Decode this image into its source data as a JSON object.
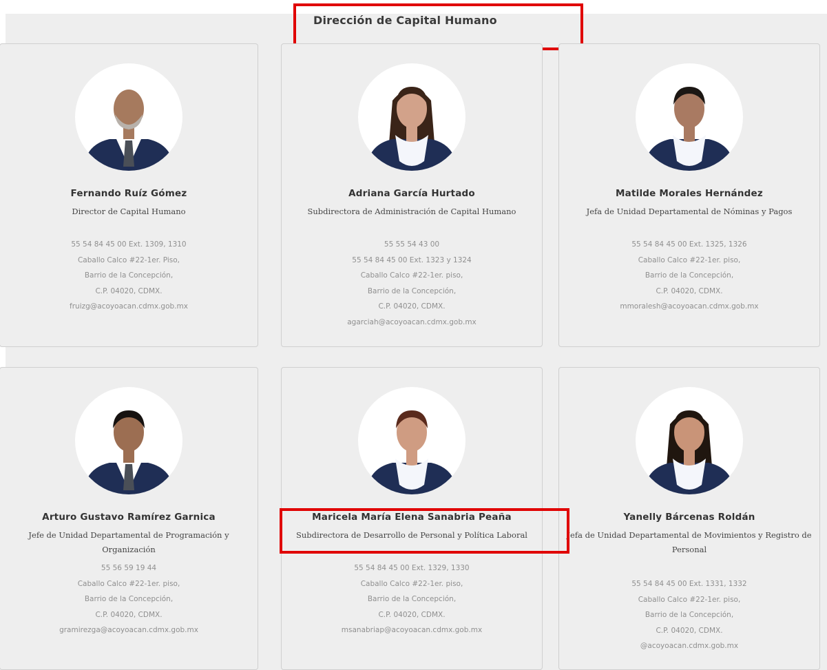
{
  "section": {
    "title": "Dirección de Capital Humano"
  },
  "colors": {
    "highlight": "#e00000",
    "card_bg": "#eeeeee",
    "suit": "#1f2e55",
    "scarf": "#f4f6fb"
  },
  "people": [
    {
      "name": "Fernando Ruíz Gómez",
      "role": "Director de Capital Humano",
      "details": [
        "55 54 84 45 00 Ext. 1309, 1310",
        "Caballo Calco #22-1er. Piso,",
        "Barrio de la Concepción,",
        "C.P. 04020, CDMX.",
        "fruizg@acoyoacan.cdmx.gob.mx"
      ],
      "photo": {
        "hair": "#2e2620",
        "skin": "#a67a5e",
        "outfit": "tie",
        "bald": true,
        "beard": true
      }
    },
    {
      "name": "Adriana García Hurtado",
      "role": "Subdirectora de Administración de Capital Humano",
      "details": [
        "55 55 54 43 00",
        "55 54 84 45 00 Ext. 1323 y 1324",
        "Caballo Calco #22-1er. piso,",
        "Barrio de la Concepción,",
        "C.P. 04020, CDMX.",
        "agarciah@acoyoacan.cdmx.gob.mx"
      ],
      "photo": {
        "hair": "#3a2418",
        "skin": "#d2a28a",
        "outfit": "scarf",
        "long_hair": true
      }
    },
    {
      "name": "Matilde Morales Hernández",
      "role": "Jefa de Unidad Departamental de Nóminas y Pagos",
      "details": [
        "55 54 84 45 00 Ext. 1325, 1326",
        "Caballo Calco #22-1er. piso,",
        "Barrio de la Concepción,",
        "C.P. 04020, CDMX.",
        "mmoralesh@acoyoacan.cdmx.gob.mx"
      ],
      "photo": {
        "hair": "#1c1714",
        "skin": "#a97a62",
        "outfit": "scarf"
      }
    },
    {
      "name": "Arturo Gustavo Ramírez Garnica",
      "role": "Jefe de Unidad Departamental de Programación y Organización",
      "details": [
        "55 56 59 19 44",
        "Caballo Calco #22-1er. piso,",
        "Barrio de la Concepción,",
        "C.P. 04020, CDMX.",
        "gramirezga@acoyoacan.cdmx.gob.mx"
      ],
      "photo": {
        "hair": "#161210",
        "skin": "#9c6e52",
        "outfit": "tie"
      }
    },
    {
      "name": "Maricela María Elena Sanabria Peaña",
      "role": "Subdirectora de Desarrollo de Personal y Política Laboral",
      "details": [
        "55 54 84 45 00 Ext. 1329, 1330",
        "Caballo Calco #22-1er. piso,",
        "Barrio de la Concepción,",
        "C.P. 04020, CDMX.",
        "msanabriap@acoyoacan.cdmx.gob.mx"
      ],
      "photo": {
        "hair": "#5a2a1c",
        "skin": "#cf9c82",
        "outfit": "scarf"
      }
    },
    {
      "name": "Yanelly Bárcenas Roldán",
      "role": "Jefa de Unidad Departamental de Movimientos y Registro de Personal",
      "details": [
        "55 54 84 45 00 Ext. 1331, 1332",
        "Caballo Calco #22-1er. piso,",
        "Barrio de la Concepción,",
        "C.P. 04020, CDMX.",
        "@acoyoacan.cdmx.gob.mx"
      ],
      "photo": {
        "hair": "#20160f",
        "skin": "#c99478",
        "outfit": "scarf",
        "long_hair": true
      }
    }
  ]
}
